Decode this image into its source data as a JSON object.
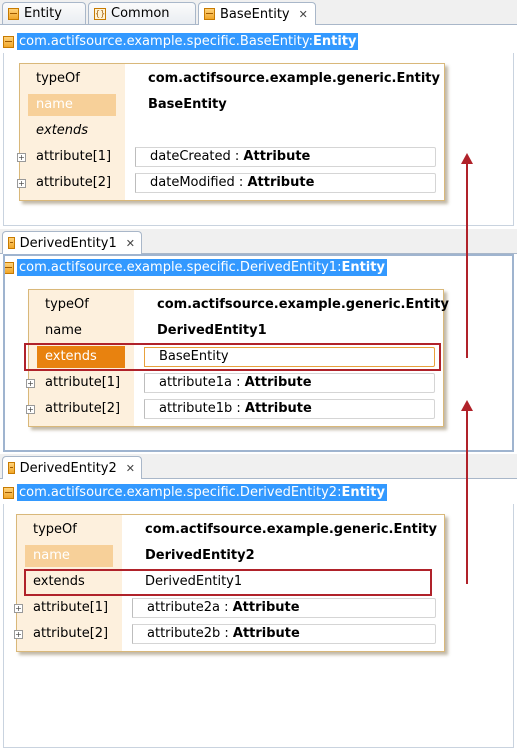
{
  "panel1": {
    "tabs": [
      {
        "label": "Entity",
        "icon": "entity-icon"
      },
      {
        "label": "Common",
        "icon": "common-icon"
      },
      {
        "label": "BaseEntity",
        "icon": "entity-icon"
      }
    ],
    "path_prefix": "com.actifsource.example.specific.BaseEntity:",
    "path_suffix": "Entity",
    "rows": {
      "typeOf": {
        "label": "typeOf",
        "value": "com.actifsource.example.generic.Entity"
      },
      "name": {
        "label": "name",
        "value": "BaseEntity"
      },
      "extends": {
        "label": "extends"
      },
      "attr1": {
        "label": "attribute[1]",
        "value": "dateCreated",
        "type": "Attribute"
      },
      "attr2": {
        "label": "attribute[2]",
        "value": "dateModified",
        "type": "Attribute"
      }
    }
  },
  "panel2": {
    "tab": "DerivedEntity1",
    "path_prefix": "com.actifsource.example.specific.DerivedEntity1:",
    "path_suffix": "Entity",
    "rows": {
      "typeOf": {
        "label": "typeOf",
        "value": "com.actifsource.example.generic.Entity"
      },
      "name": {
        "label": "name",
        "value": "DerivedEntity1"
      },
      "extends": {
        "label": "extends",
        "value": "BaseEntity"
      },
      "attr1": {
        "label": "attribute[1]",
        "value": "attribute1a",
        "type": "Attribute"
      },
      "attr2": {
        "label": "attribute[2]",
        "value": "attribute1b",
        "type": "Attribute"
      }
    }
  },
  "panel3": {
    "tab": "DerivedEntity2",
    "path_prefix": "com.actifsource.example.specific.DerivedEntity2:",
    "path_suffix": "Entity",
    "rows": {
      "typeOf": {
        "label": "typeOf",
        "value": "com.actifsource.example.generic.Entity"
      },
      "name": {
        "label": "name",
        "value": "DerivedEntity2"
      },
      "extends": {
        "label": "extends",
        "value": "DerivedEntity1"
      },
      "attr1": {
        "label": "attribute[1]",
        "value": "attribute2a",
        "type": "Attribute"
      },
      "attr2": {
        "label": "attribute[2]",
        "value": "attribute2b",
        "type": "Attribute"
      }
    }
  },
  "sep": " : ",
  "colors": {
    "selection": "#3399ff",
    "accent_orange": "#e8820f",
    "annotation_red": "#b0222a"
  }
}
